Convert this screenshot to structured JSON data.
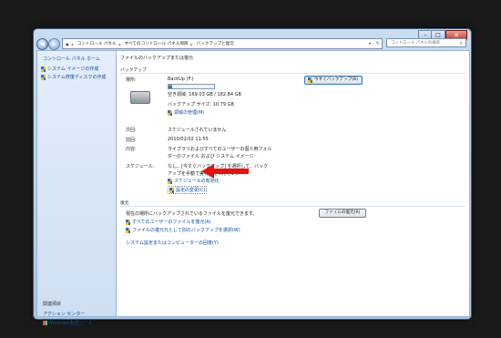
{
  "window": {
    "breadcrumb": [
      "コントロール パネル",
      "すべてのコントロール パネル項目",
      "バックアップと復元"
    ],
    "search_placeholder": "コントロール パネルの検索",
    "title_buttons": {
      "min": "–",
      "max": "□",
      "close": "✕"
    }
  },
  "sidebar": {
    "home": "コントロール パネル ホーム",
    "links": [
      "システム イメージの作成",
      "システム修復ディスクの作成"
    ],
    "see_also": "関連項目",
    "see_also_items": [
      "アクション センター",
      "Windows 転送ツール"
    ]
  },
  "main": {
    "page_title": "ファイルのバックアップまたは復元",
    "backup": {
      "section_title": "バックアップ",
      "location_label": "場所:",
      "drive_name": "BackUp (F:)",
      "free_space": "空き領域: 169.03 GB / 182.84 GB",
      "usage_fraction": 0.08,
      "backup_size": "バックアップ サイズ: 10.79 GB",
      "manage_space": "領域の管理(M)",
      "backup_now_button": "今すぐバックアップ(B)",
      "next_label": "次回:",
      "next_value": "スケジュールされていません",
      "last_label": "前回:",
      "last_value": "2010/02/02 11:55",
      "contents_label": "内容:",
      "contents_lines": [
        "ライブラリおよびすべてのユーザーの個人用フォル",
        "ダーのファイル および システム イメージ"
      ],
      "schedule_label": "スケジュール:",
      "schedule_lines": [
        "なし。[今すぐバックアップ] を選択して、バック",
        "アップを手動で実行してください。"
      ],
      "schedule_link": "スケジュールの有効化",
      "change_settings": "設定の変更(C)"
    },
    "restore": {
      "section_title": "復元",
      "description": "現在の場所にバックアップされているファイルを復元できます。",
      "restore_files_button": "ファイルの復元(R)",
      "link_all_users": "すべてのユーザーのファイルを復元(A)",
      "link_other_backup": "ファイルの復元元として別のバックアップを選択(W)",
      "link_recover_system": "システム設定またはコンピューターの回復(Y)"
    }
  },
  "annotation": {
    "arrow_color": "#e3140f"
  }
}
